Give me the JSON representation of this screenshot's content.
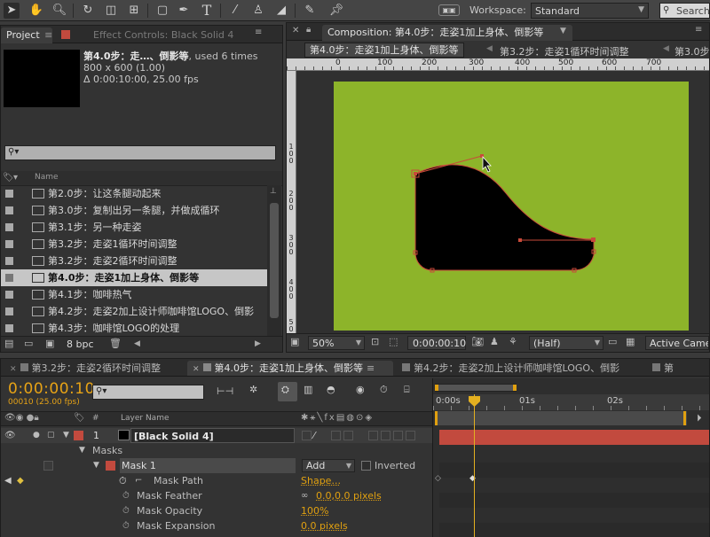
{
  "toolbar": {
    "tools": [
      "selection-tool-icon",
      "hand-tool-icon",
      "zoom-tool-icon",
      "rotate-tool-icon",
      "camera-tool-icon",
      "pan-behind-tool-icon",
      "mask-tool-icon",
      "pen-tool-icon",
      "type-tool-icon",
      "brush-tool-icon",
      "clone-stamp-tool-icon",
      "eraser-tool-icon",
      "roto-brush-tool-icon",
      "puppet-pin-tool-icon"
    ],
    "workspace_label": "Workspace:",
    "workspace_value": "Standard",
    "search_placeholder": "Search"
  },
  "project_panel": {
    "tab_project": "Project",
    "tab_effect_controls": "Effect Controls: Black Solid 4",
    "selected_name": "第4.0步：走…、倒影等",
    "used_times": ", used 6 times",
    "dimensions": "800 x 600 (1.00)",
    "duration": "Δ 0:00:10:00, 25.00 fps",
    "column_name": "Name",
    "items": [
      {
        "name": "第2.0步：让这条腿动起来",
        "selected": false
      },
      {
        "name": "第3.0步：复制出另一条腿，并做成循环",
        "selected": false
      },
      {
        "name": "第3.1步：另一种走姿",
        "selected": false
      },
      {
        "name": "第3.2步：走姿1循环时间调整",
        "selected": false
      },
      {
        "name": "第3.2步：走姿2循环时间调整",
        "selected": false
      },
      {
        "name": "第4.0步：走姿1加上身体、倒影等",
        "selected": true
      },
      {
        "name": "第4.1步：咖啡热气",
        "selected": false
      },
      {
        "name": "第4.2步：走姿2加上设计师咖啡馆LOGO、倒影",
        "selected": false
      },
      {
        "name": "第4.3步：咖啡馆LOGO的处理",
        "selected": false
      }
    ],
    "bpc": "8 bpc"
  },
  "composition_panel": {
    "tab_title": "Composition: 第4.0步：走姿1加上身体、倒影等",
    "flow_tabs": [
      "第4.0步：走姿1加上身体、倒影等",
      "第3.2步：走姿1循环时间调整",
      "第3.0步"
    ],
    "ruler_ticks": [
      "0",
      "100",
      "200",
      "300",
      "400",
      "500",
      "600",
      "700"
    ],
    "vruler_ticks": [
      "1",
      "0",
      "0",
      "2",
      "0",
      "0",
      "3",
      "0",
      "0",
      "4",
      "0",
      "0",
      "5",
      "0",
      "0"
    ],
    "canvas_color": "#8db42a",
    "zoom": "50%",
    "timecode": "0:00:00:10",
    "resolution": "(Half)",
    "camera": "Active Camera"
  },
  "timeline": {
    "tabs": [
      {
        "label": "第3.2步：走姿2循环时间调整",
        "active": false
      },
      {
        "label": "第4.0步：走姿1加上身体、倒影等",
        "active": true
      },
      {
        "label": "第4.2步：走姿2加上设计师咖啡馆LOGO、倒影",
        "active": false
      },
      {
        "label": "第",
        "active": false
      }
    ],
    "current_time": "0:00:00:10",
    "frame_info": "00010 (25.00 fps)",
    "search_placeholder": "",
    "column_layer_name": "Layer Name",
    "column_number": "#",
    "ruler_labels": [
      "0:00s",
      "01s",
      "02s"
    ],
    "layer": {
      "number": "1",
      "name": "[Black Solid 4]",
      "color": "#c24a3e"
    },
    "masks_label": "Masks",
    "mask_name": "Mask 1",
    "mask_mode": "Add",
    "inverted_label": "Inverted",
    "properties": [
      {
        "label": "Mask Path",
        "value": "Shape..."
      },
      {
        "label": "Mask Feather",
        "value": "0.0,0.0 pixels"
      },
      {
        "label": "Mask Opacity",
        "value": "100%"
      },
      {
        "label": "Mask Expansion",
        "value": "0.0 pixels"
      }
    ]
  }
}
